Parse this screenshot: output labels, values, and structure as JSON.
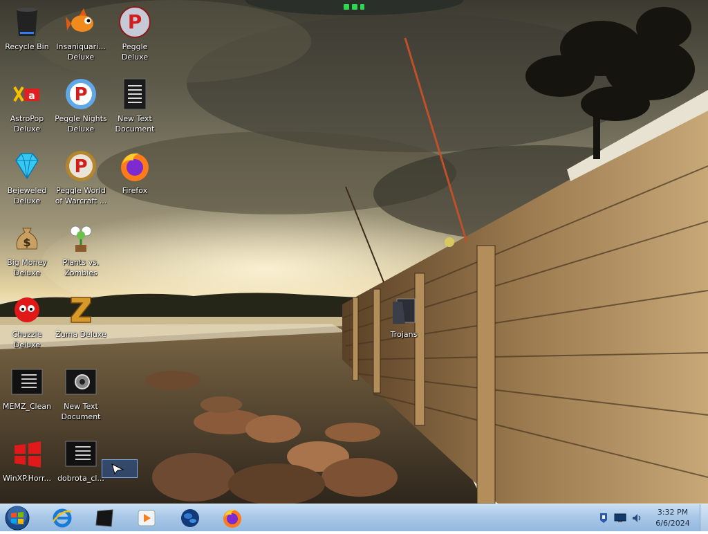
{
  "desktop": {
    "icons": [
      {
        "label": "Recycle Bin",
        "icon": "recycle-bin-icon"
      },
      {
        "label": "Insaniquari...\nDeluxe",
        "icon": "goldfish-icon"
      },
      {
        "label": "Peggle Deluxe",
        "icon": "peggle-icon"
      },
      {
        "label": "AstroPop\nDeluxe",
        "icon": "astropop-icon"
      },
      {
        "label": "Peggle Nights\nDeluxe",
        "icon": "peggle-nights-icon"
      },
      {
        "label": "New Text\nDocument",
        "icon": "text-document-icon"
      },
      {
        "label": "Bejeweled\nDeluxe",
        "icon": "gem-icon"
      },
      {
        "label": "Peggle World\nof Warcraft ...",
        "icon": "peggle-wow-icon"
      },
      {
        "label": "Firefox",
        "icon": "firefox-icon"
      },
      {
        "label": "Big Money\nDeluxe",
        "icon": "money-bag-icon"
      },
      {
        "label": "Plants vs.\nZombies",
        "icon": "plants-vs-zombies-icon"
      },
      {
        "label": "Chuzzle\nDeluxe",
        "icon": "chuzzle-icon"
      },
      {
        "label": "Zuma Deluxe",
        "icon": "zuma-icon"
      },
      {
        "label": "MEMZ_Clean",
        "icon": "console-app-icon"
      },
      {
        "label": "New Text\nDocument",
        "icon": "cog-document-icon"
      },
      {
        "label": "WinXP.Horr...",
        "icon": "windows-flag-icon"
      },
      {
        "label": "dobrota_cl...",
        "icon": "console-app-icon"
      },
      {
        "label": "Trojans",
        "icon": "folder-icon"
      }
    ]
  },
  "taskbar": {
    "start_icon": "windows-start-orb-icon",
    "pinned": [
      {
        "name": "internet-explorer",
        "icon": "internet-explorer-icon"
      },
      {
        "name": "console",
        "icon": "console-window-icon"
      },
      {
        "name": "media-player",
        "icon": "media-player-icon"
      },
      {
        "name": "globe",
        "icon": "globe-icon"
      },
      {
        "name": "firefox",
        "icon": "firefox-icon"
      }
    ],
    "tray": [
      {
        "icon": "action-center-icon"
      },
      {
        "icon": "network-monitor-icon"
      },
      {
        "icon": "volume-icon"
      }
    ],
    "clock": {
      "time": "3:32 PM",
      "date": "6/6/2024"
    }
  },
  "colors": {
    "taskbar_top": "#c9dff3",
    "taskbar_bottom": "#93b8de",
    "icon_label": "#ffffff"
  }
}
